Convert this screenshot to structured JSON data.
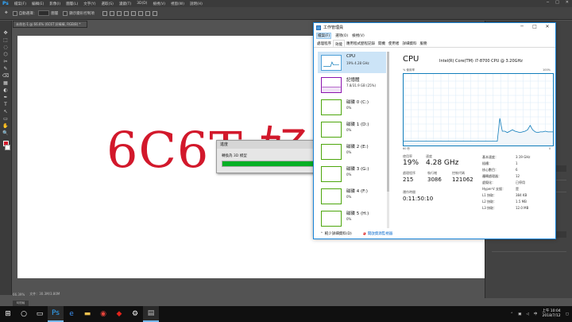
{
  "photoshop": {
    "logo": "Ps",
    "menu": [
      "檔案(F)",
      "編輯(E)",
      "影像(I)",
      "圖層(L)",
      "文字(Y)",
      "選取(S)",
      "濾鏡(T)",
      "3D(D)",
      "檢視(V)",
      "視窗(W)",
      "說明(H)"
    ],
    "options": {
      "auto_select_label": "自動選擇：",
      "layer_value": "圖層",
      "transform_label": "顯示變形控制項"
    },
    "tools": [
      "✥",
      "⬚",
      "◌",
      "⬡",
      "✂",
      "✎",
      "⌫",
      "▦",
      "◐",
      "✒",
      "T",
      "↖",
      "▭",
      "✋",
      "🔍"
    ],
    "doc_tab": "未命名-1 @ 66.6% (6C6T 好棒棒, RGB/8) *",
    "canvas_text": "6C6T 好",
    "status": {
      "zoom": "66.39%",
      "doc": "文件：30.3M/3.80M"
    },
    "timeline": "時間軸"
  },
  "progress": {
    "title": "進度",
    "message": "轉換為 3D 模型",
    "percent": 100
  },
  "taskmanager": {
    "title": "工作管理員",
    "menus": [
      "檔案(F)",
      "選項(O)",
      "檢視(V)"
    ],
    "tabs": [
      "處理程序",
      "效能",
      "應用程式歷程記錄",
      "開機",
      "使用者",
      "詳細資料",
      "服務"
    ],
    "active_tab": "效能",
    "devices": [
      {
        "name": "CPU",
        "sub": "19% 4.28 GHz"
      },
      {
        "name": "記憶體",
        "sub": "7.8/31.9 GB (25%)"
      },
      {
        "name": "磁碟 0 (C:)",
        "sub": "0%"
      },
      {
        "name": "磁碟 1 (D:)",
        "sub": "0%"
      },
      {
        "name": "磁碟 2 (E:)",
        "sub": "0%"
      },
      {
        "name": "磁碟 3 (G:)",
        "sub": "0%"
      },
      {
        "name": "磁碟 4 (F:)",
        "sub": "0%"
      },
      {
        "name": "磁碟 5 (H:)",
        "sub": "0%"
      }
    ],
    "cpu": {
      "heading": "CPU",
      "model": "Intel(R) Core(TM) i7-8700 CPU @ 3.20GHz",
      "graph_label": "% 使用率",
      "graph_max": "100%",
      "graph_time": "60 秒",
      "graph_zero": "0",
      "usage_label": "使用率",
      "usage_value": "19%",
      "speed_label": "速度",
      "speed_value": "4.28 GHz",
      "processes_label": "處理程序",
      "processes_value": "215",
      "threads_label": "執行緒",
      "threads_value": "3086",
      "handles_label": "控制代碼",
      "handles_value": "121062",
      "uptime_label": "運作時間",
      "uptime_value": "0:11:50:10",
      "specs": [
        {
          "label": "基本速度：",
          "value": "3.19 GHz"
        },
        {
          "label": "插槽：",
          "value": "1"
        },
        {
          "label": "核心數目：",
          "value": "6"
        },
        {
          "label": "邏輯處理器：",
          "value": "12"
        },
        {
          "label": "虛擬化：",
          "value": "已停用"
        },
        {
          "label": "Hyper-V 支援：",
          "value": "是"
        },
        {
          "label": "L1 快取：",
          "value": "384 KB"
        },
        {
          "label": "L2 快取：",
          "value": "1.5 MB"
        },
        {
          "label": "L3 快取：",
          "value": "12.0 MB"
        }
      ],
      "usage_history_percent": [
        6,
        6,
        6,
        6,
        6,
        6,
        6,
        6,
        6,
        6,
        6,
        6,
        6,
        6,
        6,
        6,
        6,
        6,
        6,
        6,
        6,
        6,
        6,
        6,
        6,
        6,
        6,
        6,
        6,
        6,
        6,
        6,
        6,
        6,
        6,
        6,
        6,
        6,
        38,
        20,
        20,
        18,
        20,
        22,
        20,
        19,
        18,
        19,
        20,
        22,
        28,
        22,
        19,
        18,
        19,
        19,
        20,
        19,
        19,
        19
      ]
    },
    "footer": {
      "fewer_details": "較少詳細資料(D)",
      "resource_monitor": "開啟資源監視器"
    }
  },
  "taskbar": {
    "apps": [
      {
        "name": "photoshop",
        "glyph": "Ps",
        "color": "#31a8ff",
        "active": true
      },
      {
        "name": "edge",
        "glyph": "e",
        "color": "#3c8ff0",
        "active": false
      },
      {
        "name": "explorer",
        "glyph": "▬",
        "color": "#f2c14e",
        "active": false
      },
      {
        "name": "chrome",
        "glyph": "◉",
        "color": "#e8453c",
        "active": false
      },
      {
        "name": "roblox",
        "glyph": "◆",
        "color": "#e2231a",
        "active": false
      },
      {
        "name": "settings",
        "glyph": "⚙",
        "color": "#ffffff",
        "active": false
      },
      {
        "name": "taskmanager",
        "glyph": "▤",
        "color": "#bfbfbf",
        "active": true
      }
    ],
    "clock_time": "上午 10:04",
    "clock_date": "2018/7/12"
  }
}
